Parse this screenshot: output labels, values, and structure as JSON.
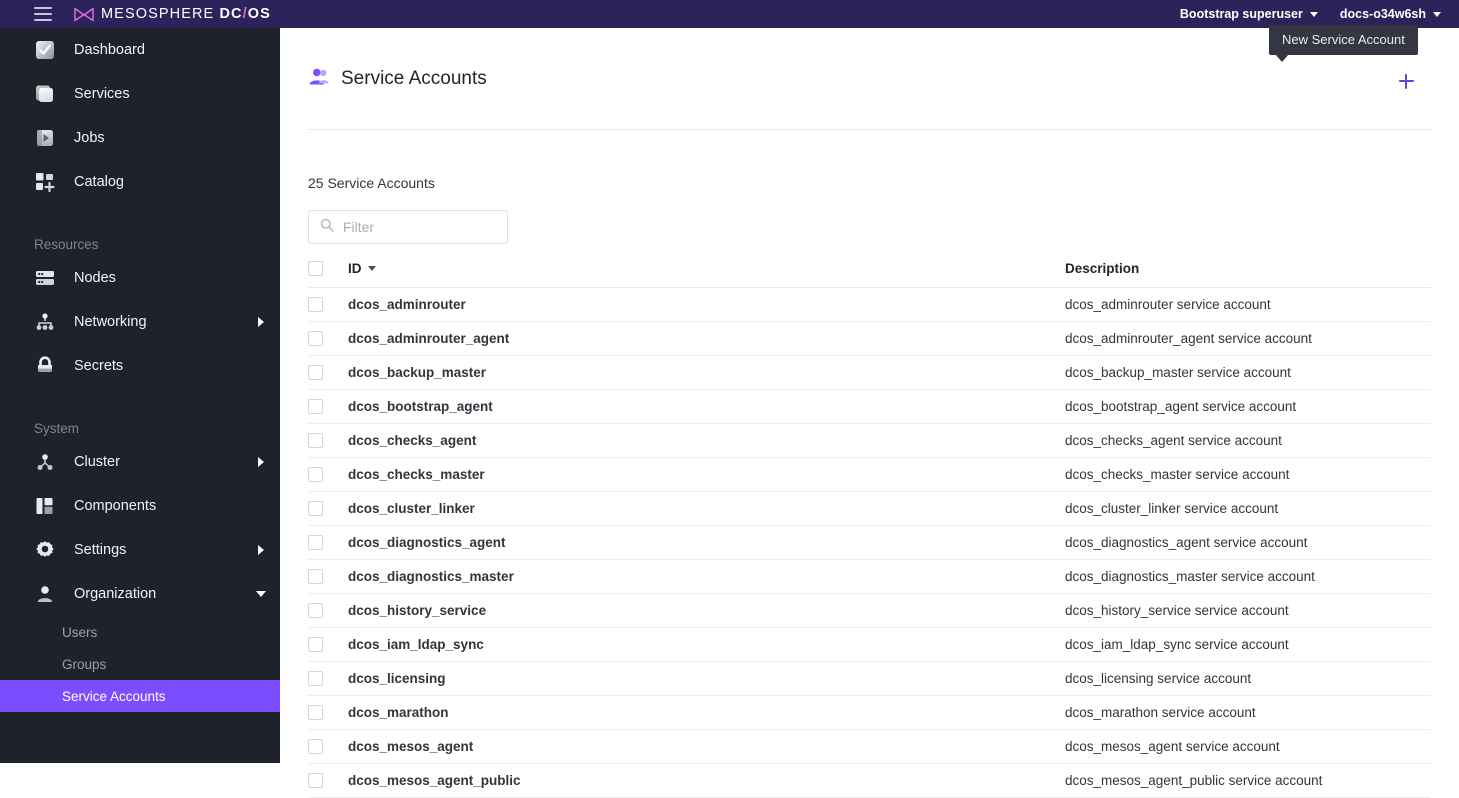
{
  "topbar": {
    "menu_icon": "hamburger-icon",
    "logo_icon": "mesosphere-logo-icon",
    "brand_prefix": "MESOSPHERE ",
    "brand_dc": "DC",
    "brand_slash": "/",
    "brand_os": "OS",
    "user_menu": "Bootstrap superuser",
    "cluster_menu": "docs-o34w6sh"
  },
  "tooltip": {
    "text": "New Service Account"
  },
  "sidebar": {
    "items": [
      {
        "label": "Dashboard",
        "icon": "dashboard-icon",
        "arrow": "none"
      },
      {
        "label": "Services",
        "icon": "services-icon",
        "arrow": "none"
      },
      {
        "label": "Jobs",
        "icon": "jobs-icon",
        "arrow": "none"
      },
      {
        "label": "Catalog",
        "icon": "catalog-icon",
        "arrow": "none"
      }
    ],
    "resources_section": "Resources",
    "resources_items": [
      {
        "label": "Nodes",
        "icon": "nodes-icon",
        "arrow": "none"
      },
      {
        "label": "Networking",
        "icon": "networking-icon",
        "arrow": "right"
      },
      {
        "label": "Secrets",
        "icon": "lock-icon",
        "arrow": "none"
      }
    ],
    "system_section": "System",
    "system_items": [
      {
        "label": "Cluster",
        "icon": "cluster-icon",
        "arrow": "right"
      },
      {
        "label": "Components",
        "icon": "components-icon",
        "arrow": "none"
      },
      {
        "label": "Settings",
        "icon": "gear-icon",
        "arrow": "right"
      },
      {
        "label": "Organization",
        "icon": "user-icon",
        "arrow": "down"
      }
    ],
    "organization_children": [
      {
        "label": "Users",
        "active": false
      },
      {
        "label": "Groups",
        "active": false
      },
      {
        "label": "Service Accounts",
        "active": true
      }
    ],
    "active_color": "#7b4dff"
  },
  "page": {
    "title": "Service Accounts",
    "title_icon": "service-account-user-icon",
    "add_button": "new-service-account-button",
    "count_label": "25 Service Accounts",
    "filter_placeholder": "Filter",
    "filter_value": "",
    "accent_color": "#5c45e0"
  },
  "table": {
    "columns": [
      "ID",
      "Description"
    ],
    "sort_column": "ID",
    "sort_direction": "desc",
    "rows": [
      {
        "id": "dcos_adminrouter",
        "description": "dcos_adminrouter service account"
      },
      {
        "id": "dcos_adminrouter_agent",
        "description": "dcos_adminrouter_agent service account"
      },
      {
        "id": "dcos_backup_master",
        "description": "dcos_backup_master service account"
      },
      {
        "id": "dcos_bootstrap_agent",
        "description": "dcos_bootstrap_agent service account"
      },
      {
        "id": "dcos_checks_agent",
        "description": "dcos_checks_agent service account"
      },
      {
        "id": "dcos_checks_master",
        "description": "dcos_checks_master service account"
      },
      {
        "id": "dcos_cluster_linker",
        "description": "dcos_cluster_linker service account"
      },
      {
        "id": "dcos_diagnostics_agent",
        "description": "dcos_diagnostics_agent service account"
      },
      {
        "id": "dcos_diagnostics_master",
        "description": "dcos_diagnostics_master service account"
      },
      {
        "id": "dcos_history_service",
        "description": "dcos_history_service service account"
      },
      {
        "id": "dcos_iam_ldap_sync",
        "description": "dcos_iam_ldap_sync service account"
      },
      {
        "id": "dcos_licensing",
        "description": "dcos_licensing service account"
      },
      {
        "id": "dcos_marathon",
        "description": "dcos_marathon service account"
      },
      {
        "id": "dcos_mesos_agent",
        "description": "dcos_mesos_agent service account"
      },
      {
        "id": "dcos_mesos_agent_public",
        "description": "dcos_mesos_agent_public service account"
      }
    ]
  }
}
